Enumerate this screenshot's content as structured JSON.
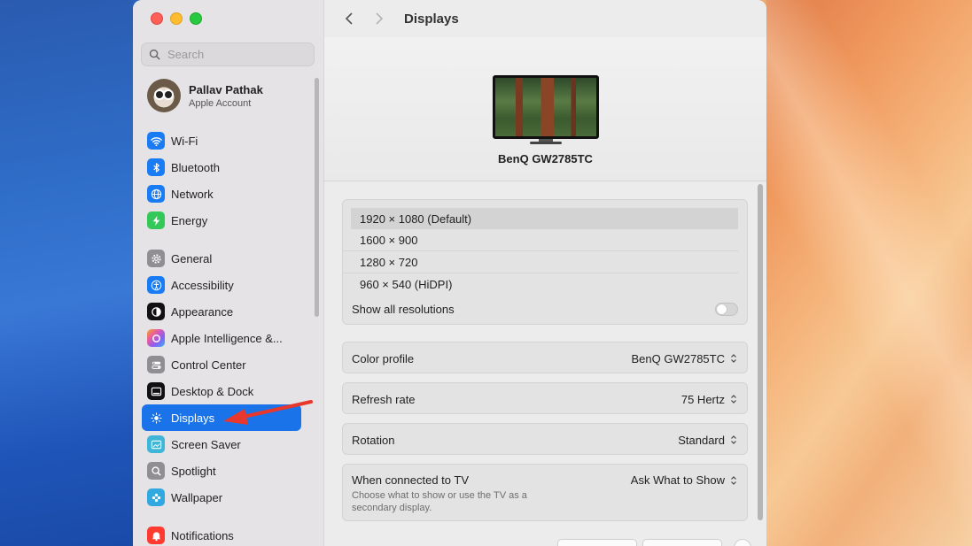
{
  "window": {
    "title": "Displays"
  },
  "search": {
    "placeholder": "Search"
  },
  "account": {
    "name": "Pallav Pathak",
    "subtitle": "Apple Account"
  },
  "sidebar": {
    "items": [
      {
        "label": "Wi-Fi",
        "icon": "wifi-icon",
        "color": "#1a7cf5"
      },
      {
        "label": "Bluetooth",
        "icon": "bluetooth-icon",
        "color": "#1a7cf5"
      },
      {
        "label": "Network",
        "icon": "globe-icon",
        "color": "#1a7cf5"
      },
      {
        "label": "Energy",
        "icon": "bolt-icon",
        "color": "#34c759"
      },
      {
        "label": "General",
        "icon": "gear-icon",
        "color": "#8e8e93"
      },
      {
        "label": "Accessibility",
        "icon": "accessibility-icon",
        "color": "#1a7cf5"
      },
      {
        "label": "Appearance",
        "icon": "appearance-icon",
        "color": "#111111"
      },
      {
        "label": "Apple Intelligence &...",
        "icon": "apple-intelligence-icon",
        "color": "#e85da0"
      },
      {
        "label": "Control Center",
        "icon": "toggles-icon",
        "color": "#8e8e93"
      },
      {
        "label": "Desktop & Dock",
        "icon": "dock-icon",
        "color": "#111111"
      },
      {
        "label": "Displays",
        "icon": "sun-icon",
        "color": "#1a7cf5"
      },
      {
        "label": "Screen Saver",
        "icon": "screensaver-icon",
        "color": "#3fb6d8"
      },
      {
        "label": "Spotlight",
        "icon": "magnifier-icon",
        "color": "#8e8e93"
      },
      {
        "label": "Wallpaper",
        "icon": "flower-icon",
        "color": "#31a8e0"
      },
      {
        "label": "Notifications",
        "icon": "bell-icon",
        "color": "#ff3b30"
      }
    ]
  },
  "display": {
    "name": "BenQ GW2785TC"
  },
  "resolutions": {
    "options": [
      "1920 × 1080 (Default)",
      "1600 × 900",
      "1280 × 720",
      "960 × 540 (HiDPI)"
    ],
    "selected": "1920 × 1080 (Default)",
    "show_all_label": "Show all resolutions",
    "show_all_on": false
  },
  "settings": {
    "color_profile": {
      "label": "Color profile",
      "value": "BenQ GW2785TC"
    },
    "refresh_rate": {
      "label": "Refresh rate",
      "value": "75 Hertz"
    },
    "rotation": {
      "label": "Rotation",
      "value": "Standard"
    },
    "tv": {
      "label": "When connected to TV",
      "value": "Ask What to Show",
      "description": "Choose what to show or use the TV as a secondary display."
    }
  },
  "colors": {
    "accent": "#1a73e8",
    "annotation_arrow": "#e8372c"
  }
}
